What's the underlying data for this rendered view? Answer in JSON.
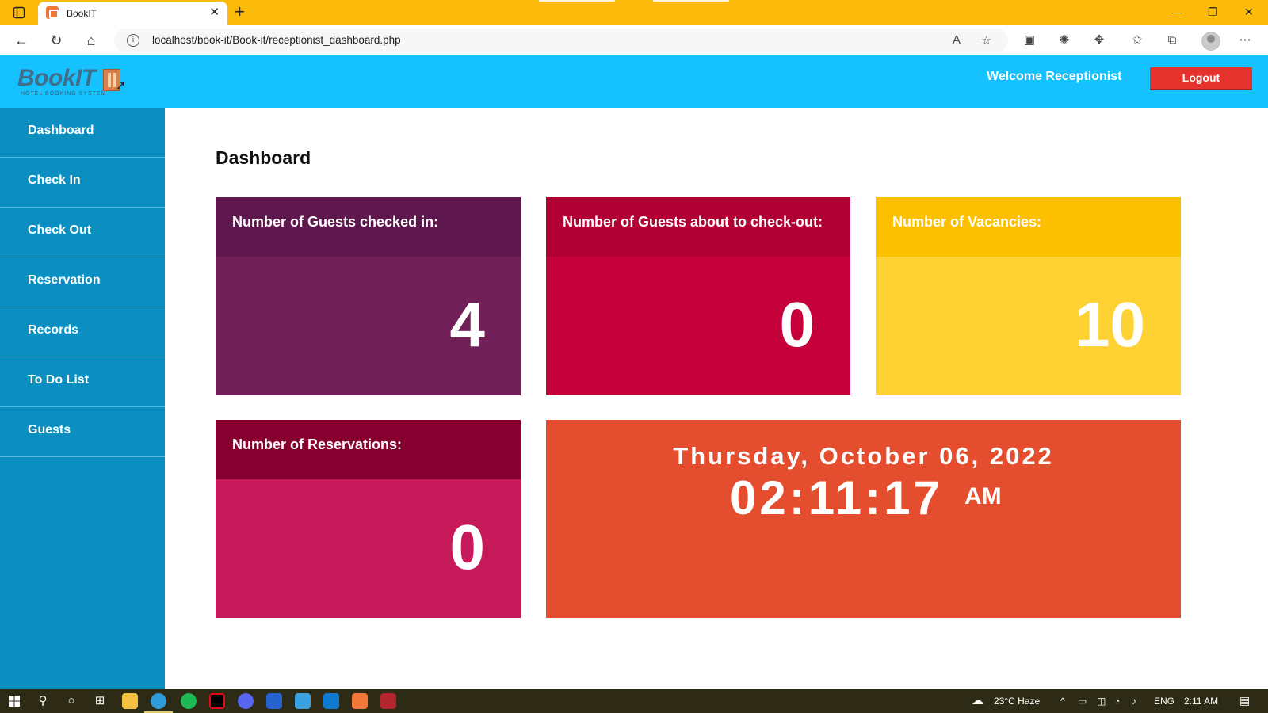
{
  "browser": {
    "tab_title": "BookIT",
    "close_glyph": "✕",
    "new_tab_glyph": "+",
    "url": "localhost/book-it/Book-it/receptionist_dashboard.php",
    "info_glyph": "i",
    "minimize_glyph": "—",
    "restore_glyph": "❐",
    "window_close_glyph": "✕",
    "more_glyph": "⋯"
  },
  "header": {
    "logo_text": "BookIT",
    "logo_subtitle": "HOTEL BOOKING SYSTEM",
    "welcome": "Welcome Receptionist",
    "logout_label": "Logout"
  },
  "sidebar": {
    "items": [
      {
        "label": "Dashboard"
      },
      {
        "label": "Check In"
      },
      {
        "label": "Check Out"
      },
      {
        "label": "Reservation"
      },
      {
        "label": "Records"
      },
      {
        "label": "To Do List"
      },
      {
        "label": "Guests"
      }
    ]
  },
  "main": {
    "title": "Dashboard",
    "cards": [
      {
        "title": "Number of Guests checked in:",
        "value": "4",
        "head_color": "#5e184d",
        "body_color": "#711f57"
      },
      {
        "title": "Number of Guests about to check-out:",
        "value": "0",
        "head_color": "#b10034",
        "body_color": "#c6003b"
      },
      {
        "title": "Number of Vacancies:",
        "value": "10",
        "head_color": "#fdc001",
        "body_color": "#ffd233"
      },
      {
        "title": "Number of Reservations:",
        "value": "0",
        "head_color": "#860030",
        "body_color": "#c6195a"
      }
    ],
    "clock": {
      "date": "Thursday, October 06, 2022",
      "time": "02:11:17",
      "ampm": "AM",
      "color": "#e44e2f"
    }
  },
  "taskbar": {
    "weather": "23°C  Haze",
    "language": "ENG",
    "time": "2:11 AM"
  },
  "colors": {
    "browser_tabbar": "#fcba0b",
    "app_header": "#15c2ff",
    "sidebar": "#0b8ec0",
    "logout": "#e5322c"
  }
}
